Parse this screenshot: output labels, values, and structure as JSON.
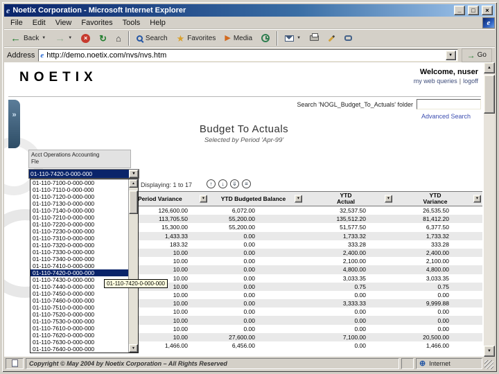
{
  "window": {
    "title": "Noetix Corporation - Microsoft Internet Explorer"
  },
  "icons": {
    "ie_logo": "e",
    "minimize": "_",
    "maximize": "□",
    "close": "×",
    "back_arrow": "←",
    "forward_arrow": "→",
    "stop": "×",
    "refresh": "↻",
    "home": "⌂",
    "dropdown_arrow": "▼",
    "up_arrow": "▲",
    "down_arrow": "▼",
    "go_arrow": "→",
    "collapse_chevron": "»",
    "globe": "⊕",
    "sort": "▼"
  },
  "menu": {
    "items": [
      "File",
      "Edit",
      "View",
      "Favorites",
      "Tools",
      "Help"
    ]
  },
  "toolbar": {
    "back_label": "Back",
    "search_label": "Search",
    "favorites_label": "Favorites",
    "media_label": "Media"
  },
  "address": {
    "label": "Address",
    "url": "http://demo.noetix.com/nvs/nvs.htm",
    "go_label": "Go"
  },
  "page": {
    "logo_text": "NOETIX",
    "welcome": "Welcome, nuser",
    "nav_links": [
      "my web queries",
      "logoff"
    ],
    "link_separator": "|",
    "search_prompt": "Search 'NOGL_Budget_To_Actuals' folder",
    "search_input_value": "",
    "advanced_search": "Advanced Search",
    "title": "Budget To Actuals",
    "subtitle": "Selected by Period 'Apr-99'",
    "param_label_line1": "Acct Operations Accounting",
    "param_label_line2": "Fle",
    "combo_value": "01-110-7420-0-000-000",
    "tooltip": "01-110-7420-0-000-000"
  },
  "dropdown": {
    "highlighted_index": 13,
    "items": [
      "01-110-7100-0-000-000",
      "01-110-7110-0-000-000",
      "01-110-7120-0-000-000",
      "01-110-7130-0-000-000",
      "01-110-7140-0-000-000",
      "01-110-7210-0-000-000",
      "01-110-7220-0-000-000",
      "01-110-7230-0-000-000",
      "01-110-7310-0-000-000",
      "01-110-7320-0-000-000",
      "01-110-7330-0-000-000",
      "01-110-7340-0-000-000",
      "01-110-7410-0-000-000",
      "01-110-7420-0-000-000",
      "01-110-7430-0-000-000",
      "01-110-7440-0-000-000",
      "01-110-7450-0-000-000",
      "01-110-7460-0-000-000",
      "01-110-7510-0-000-000",
      "01-110-7520-0-000-000",
      "01-110-7530-0-000-000",
      "01-110-7610-0-000-000",
      "01-110-7620-0-000-000",
      "01-110-7630-0-000-000",
      "01-110-7640-0-000-000"
    ]
  },
  "results": {
    "displaying": "Displaying: 1 to 17",
    "pager": [
      {
        "name": "page-up-icon",
        "glyph": "↑"
      },
      {
        "name": "page-down-icon",
        "glyph": "↓"
      },
      {
        "name": "page-last-icon",
        "glyph": "⇓"
      },
      {
        "name": "options-icon",
        "glyph": "≡"
      }
    ],
    "columns": [
      "Period Variance",
      "YTD Budgeted Balance",
      "YTD\nActual",
      "YTD\nVariance"
    ],
    "rows": [
      [
        "126,600.00",
        "6,072.00",
        "32,537.50",
        "26,535.50"
      ],
      [
        "113,705.50",
        "55,200.00",
        "135,512.20",
        "81,412.20"
      ],
      [
        "15,300.00",
        "55,200.00",
        "51,577.50",
        "6,377.50"
      ],
      [
        "1,433.33",
        "0.00",
        "1,733.32",
        "1,733.32"
      ],
      [
        "183.32",
        "0.00",
        "333.28",
        "333.28"
      ],
      [
        "10.00",
        "0.00",
        "2,400.00",
        "2,400.00"
      ],
      [
        "10.00",
        "0.00",
        "2,100.00",
        "2,100.00"
      ],
      [
        "10.00",
        "0.00",
        "4,800.00",
        "4,800.00"
      ],
      [
        "10.00",
        "0.00",
        "3,033.35",
        "3,033.35"
      ],
      [
        "10.00",
        "0.00",
        "0.75",
        "0.75"
      ],
      [
        "10.00",
        "0.00",
        "0.00",
        "0.00"
      ],
      [
        "10.00",
        "0.00",
        "3,333.33",
        "9,999.88"
      ],
      [
        "10.00",
        "0.00",
        "0.00",
        "0.00"
      ],
      [
        "10.00",
        "0.00",
        "0.00",
        "0.00"
      ],
      [
        "10.00",
        "0.00",
        "0.00",
        "0.00"
      ],
      [
        "10.00",
        "27,600.00",
        "7,100.00",
        "20,500.00"
      ],
      [
        "1,466.00",
        "6,456.00",
        "0.00",
        "1,466.00"
      ]
    ]
  },
  "status": {
    "text": "Copyright © May 2004 by Noetix Corporation – All Rights Reserved",
    "zone": "Internet"
  }
}
